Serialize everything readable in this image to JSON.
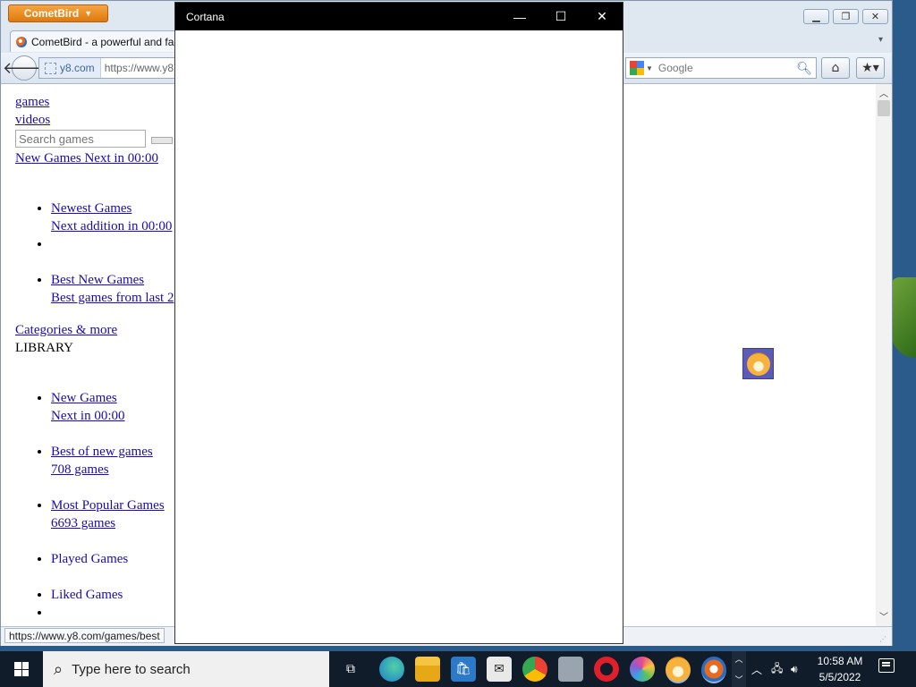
{
  "browser": {
    "app_menu_label": "CometBird",
    "tab_title": "CometBird - a powerful and fa",
    "site_identity": "y8.com",
    "url": "https://www.y8",
    "search_engine": "Google",
    "status_url": "https://www.y8.com/games/best"
  },
  "page": {
    "links_top": [
      "games",
      "videos"
    ],
    "search_placeholder": "Search games",
    "new_games_link": "New Games Next in  00:00",
    "list1": [
      {
        "title": "Newest Games",
        "sub": "Next addition in 00:00"
      },
      {
        "title": "",
        "sub": ""
      },
      {
        "title": "Best New Games",
        "sub": "Best games from last 2"
      }
    ],
    "categories_link": "Categories & more",
    "library_label": "LIBRARY",
    "library": [
      {
        "title": "New Games",
        "sub": "Next in 00:00"
      },
      {
        "title": "Best of new games",
        "sub": "708 games"
      },
      {
        "title": "Most Popular Games",
        "sub": "6693 games"
      },
      {
        "title": "Played Games",
        "sub": ""
      },
      {
        "title": "Liked Games",
        "sub": ""
      }
    ]
  },
  "cortana": {
    "title": "Cortana"
  },
  "taskbar": {
    "search_placeholder": "Type here to search",
    "time": "10:58 AM",
    "date": "5/5/2022"
  },
  "colors": {
    "taskbar": "#101c2a",
    "cortana_titlebar": "#000000",
    "link": "#1a0dab",
    "appmenu": "#e88a1f"
  }
}
